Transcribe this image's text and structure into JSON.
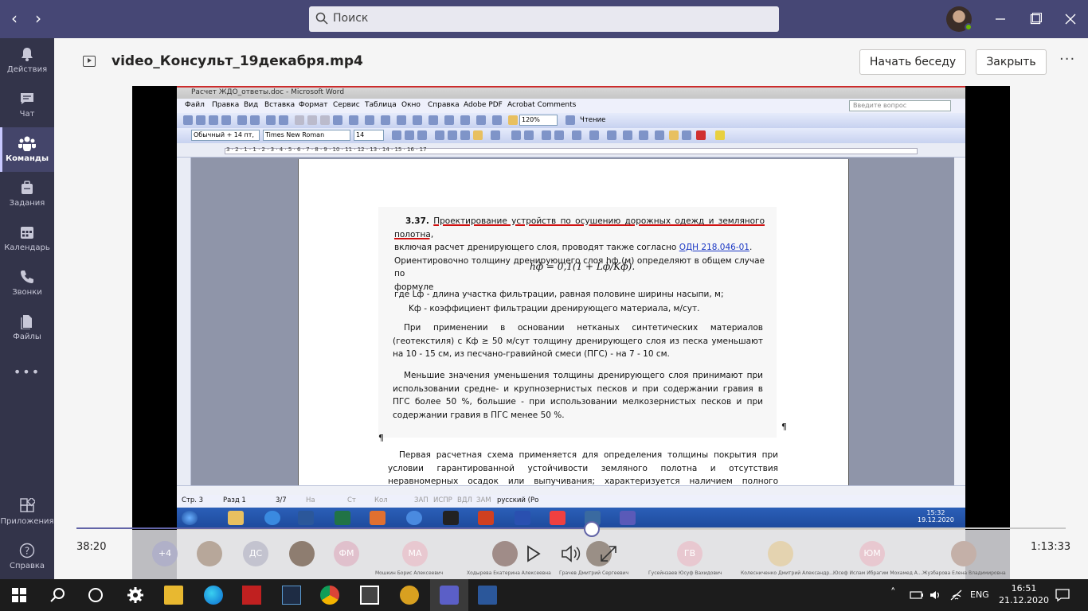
{
  "titlebar": {
    "search_placeholder": "Поиск",
    "nav_back": "‹",
    "nav_fwd": "›"
  },
  "rail": {
    "items": [
      {
        "label": "Действия",
        "icon": "bell-icon"
      },
      {
        "label": "Чат",
        "icon": "chat-icon"
      },
      {
        "label": "Команды",
        "icon": "teams-icon"
      },
      {
        "label": "Задания",
        "icon": "assignments-icon"
      },
      {
        "label": "Календарь",
        "icon": "calendar-icon"
      },
      {
        "label": "Звонки",
        "icon": "phone-icon"
      },
      {
        "label": "Файлы",
        "icon": "files-icon"
      },
      {
        "label": "Приложения",
        "icon": "apps-icon"
      },
      {
        "label": "Справка",
        "icon": "help-icon"
      }
    ],
    "more": "•••"
  },
  "header": {
    "file_name": "video_Консульт_19декабря.mp4",
    "start_chat": "Начать беседу",
    "close": "Закрыть",
    "more": "···"
  },
  "word": {
    "title": "Расчет ЖДО_ответы.doc - Microsoft Word",
    "menu": [
      "Файл",
      "Правка",
      "Вид",
      "Вставка",
      "Формат",
      "Сервис",
      "Таблица",
      "Окно",
      "Справка",
      "Adobe PDF",
      "Acrobat Comments"
    ],
    "ask": "Введите вопрос",
    "zoom": "120%",
    "reading": "Чтение",
    "style": "Обычный + 14 пт,",
    "font": "Times New Roman",
    "size": "14",
    "ruler_marks": "3 · 2 · 1 · 1 · 2 · 3 · 4 · 5 · 6 · 7 · 8 · 9 · 10 · 11 · 12 · 13 · 14 · 15 · 16 · 17",
    "doc": {
      "p1_num": "3.37.",
      "p1_title": "Проектирование устройств по осушению дорожных одежд и земляного полотна,",
      "p1_line2a": "включая расчет дренирующего слоя, проводят также согласно",
      "p1_link": "ОДН 218.046-01",
      "p1_line3": "Ориентировочно толщину дренирующего слоя hф (м) определяют в общем случае по",
      "p1_line4": "формуле",
      "formula": "hф = 0,1(1 + Lф/Kф).",
      "where1": "где Lф - длина участка фильтрации, равная половине ширины насыпи, м;",
      "where2": "Kф - коэффициент фильтрации дренирующего материала, м/сут.",
      "p2": "При применении в основании нетканых синтетических материалов (геотекстиля) с Kф ≥ 50 м/сут толщину дренирующего слоя из песка уменьшают на 10 - 15 см, из песчано-гравийной смеси (ПГС) - на 7 - 10 см.",
      "p3": "Меньшие значения уменьшения толщины дренирующего слоя принимают при использовании средне- и крупнозернистых песков и при содержании гравия в ПГС более 50 %, большие - при использовании мелкозернистых песков и при содержании гравия в ПГС менее 50 %.",
      "pilcrow": "¶",
      "p4": "Первая расчетная схема применяется для определения толщины покрытия при условии гарантированной устойчивости земляного полотна и отсутствия неравномерных осадок или выпучивания; характеризуется наличием полного контакта плит с основанием под"
    },
    "status": {
      "page": "Стр. 3",
      "section": "Разд 1",
      "pages": "3/7",
      "at": "На",
      "ln": "Ст",
      "col": "Кол",
      "rec": "ЗАП",
      "trk": "ИСПР",
      "ext": "ВДЛ",
      "ovr": "ЗАМ",
      "lang": "русский (Ро"
    },
    "clock_time": "15:32",
    "clock_date": "19.12.2020"
  },
  "player": {
    "elapsed": "38:20",
    "duration": "1:13:33",
    "progress": 0.521,
    "participants": [
      {
        "initials": "+4",
        "color": "#b0b0c8"
      },
      {
        "initials": "",
        "color": "#b7a79a"
      },
      {
        "initials": "ДС",
        "color": "#c3c3cf"
      },
      {
        "initials": "",
        "color": "#8e7d70"
      },
      {
        "initials": "ФМ",
        "color": "#e0c0cc"
      },
      {
        "initials": "МА",
        "color": "#e8c8d0",
        "name": "Мошкин Борис Алексеевич"
      },
      {
        "initials": "",
        "color": "#a08c88",
        "name": "Ходырева Екатерина Алексеевна"
      },
      {
        "initials": "",
        "color": "#9a8f86",
        "name": "Грачев Дмитрий Сергеевич"
      },
      {
        "initials": "ГВ",
        "color": "#e8c8d0",
        "name": "Гусейнзаев Юсуф Вахидович"
      },
      {
        "initials": "",
        "color": "#e4d3b0",
        "name": "Колесниченко Дмитрий Александр..."
      },
      {
        "initials": "ЮМ",
        "color": "#e8c8d0",
        "name": "Юсеф Ислам Ибрагим Мохамед А..."
      },
      {
        "initials": "",
        "color": "#c4b0a8",
        "name": "Жузбарова Елена Владимировна"
      }
    ]
  },
  "taskbar": {
    "lang": "ENG",
    "time": "16:51",
    "date": "21.12.2020"
  }
}
